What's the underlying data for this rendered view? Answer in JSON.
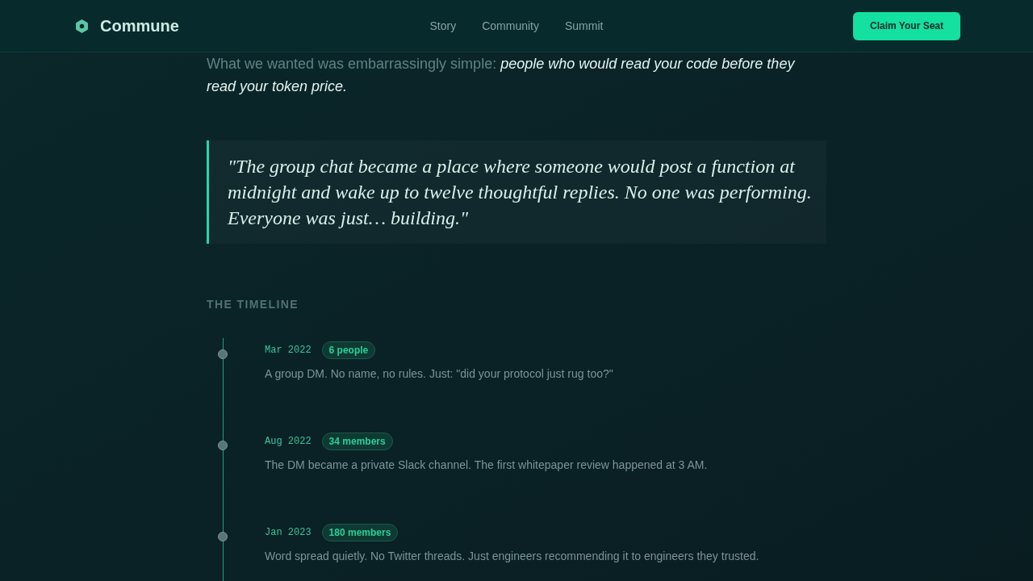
{
  "nav": {
    "brand": "Commune",
    "links": [
      "Story",
      "Community",
      "Summit"
    ],
    "cta": "Claim Your Seat"
  },
  "intro": "What we wanted was embarrassingly simple: *people who would read your code before they read your token price.*",
  "quote": "\"The group chat became a place where someone would post a function at midnight and wake up to twelve thoughtful replies. No one was performing. Everyone was just… building.\"",
  "timeline": {
    "heading": "THE TIMELINE",
    "events": [
      {
        "date": "Mar 2022",
        "badge": "6 people",
        "text": "A group DM. No name, no rules. Just: \"did your protocol just rug too?\""
      },
      {
        "date": "Aug 2022",
        "badge": "34 members",
        "text": "The DM became a private Slack channel. The first whitepaper review happened at 3 AM."
      },
      {
        "date": "Jan 2023",
        "badge": "180 members",
        "text": "Word spread quietly. No Twitter threads. Just engineers recommending it to engineers they trusted."
      }
    ]
  }
}
